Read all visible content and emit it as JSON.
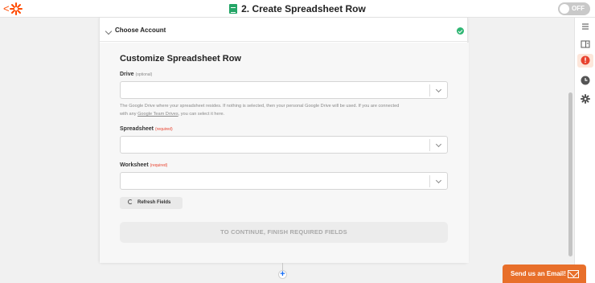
{
  "header": {
    "back_glyph": "<",
    "title": "2. Create Spreadsheet Row",
    "toggle_label": "OFF"
  },
  "choose_account": {
    "label": "Choose Account",
    "status": "complete"
  },
  "form": {
    "title": "Customize Spreadsheet Row",
    "drive": {
      "label": "Drive",
      "tag": "(optional)",
      "value": "",
      "help_text_1": "The Google Drive where your spreadsheet resides. If nothing is selected, then your personal Google Drive will be used. If you are connected",
      "help_text_2": "with any ",
      "help_link": "Google Team Drives",
      "help_text_3": ", you can select it here."
    },
    "spreadsheet": {
      "label": "Spreadsheet",
      "tag": "(required)",
      "value": ""
    },
    "worksheet": {
      "label": "Worksheet",
      "tag": "(required)",
      "value": ""
    },
    "refresh_label": "Refresh Fields",
    "continue_label": "TO CONTINUE, FINISH REQUIRED FIELDS"
  },
  "add_step_glyph": "+",
  "email_widget": {
    "label": "Send us an Email!"
  },
  "rail_icons": [
    "list-icon",
    "panel-icon",
    "alert-icon",
    "clock-icon",
    "gear-icon"
  ],
  "colors": {
    "brand": "#ff4a00",
    "success": "#2fb673",
    "required": "#e8432f",
    "widget": "#e86f2a",
    "sheets": "#23a566"
  }
}
